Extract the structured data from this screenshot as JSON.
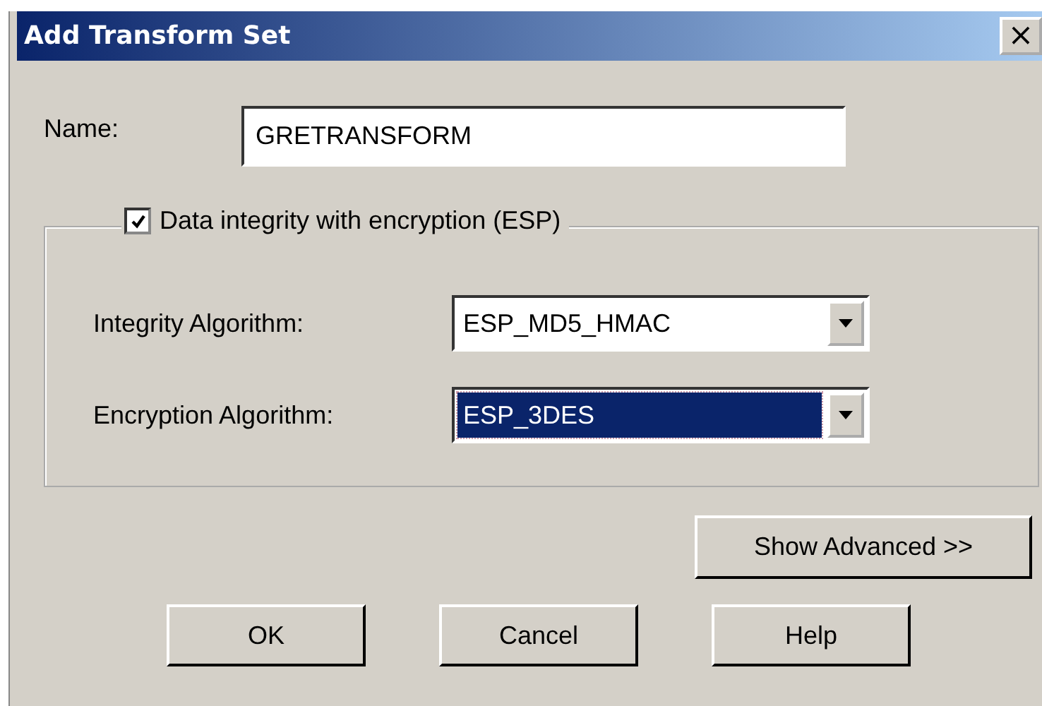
{
  "window": {
    "title": "Add Transform Set",
    "close": "×"
  },
  "name_field": {
    "label": "Name:",
    "value": "GRETRANSFORM"
  },
  "esp_group": {
    "label": "Data integrity with encryption (ESP)",
    "checked": true,
    "fields": [
      {
        "label": "Integrity Algorithm:",
        "value": "ESP_MD5_HMAC",
        "focused": false
      },
      {
        "label": "Encryption Algorithm:",
        "value": "ESP_3DES",
        "focused": true
      }
    ]
  },
  "advanced_button": "Show Advanced >>",
  "buttons": [
    "OK",
    "Cancel",
    "Help"
  ]
}
